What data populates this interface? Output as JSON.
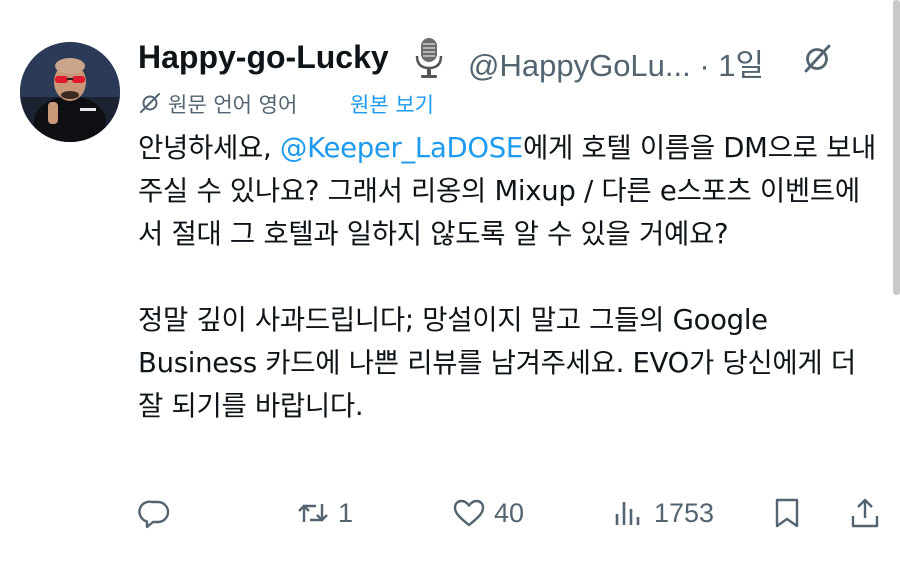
{
  "author": {
    "display_name": "Happy-go-Lucky",
    "handle_time": "@HappyGoLu... · 1일"
  },
  "translation": {
    "label": "원문 언어 영어",
    "show_original": "원본 보기"
  },
  "tweet": {
    "line1_before": "안녕하세요, ",
    "mention": "@Keeper_LaDOSE",
    "line1_after": "에게 호텔 이름을 DM으로 보내주실 수 있나요? 그래서 리옹의 Mixup / 다른 e스포츠 이벤트에서 절대 그 호텔과 일하지 않도록 알 수 있을 거예요?",
    "paragraph2": "정말 깊이 사과드립니다; 망설이지 말고 그들의 Google Business 카드에 나쁜 리뷰를 남겨주세요. EVO가 당신에게 더 잘 되기를 바랍니다."
  },
  "actions": {
    "retweet_count": "1",
    "like_count": "40",
    "views_count": "1753"
  },
  "colors": {
    "accent": "#1d9bf0",
    "secondary_text": "#536471",
    "primary_text": "#0f1419"
  },
  "icons": [
    "microphone-icon",
    "translate-icon",
    "reply-icon",
    "retweet-icon",
    "like-icon",
    "views-icon",
    "bookmark-icon",
    "share-icon"
  ]
}
